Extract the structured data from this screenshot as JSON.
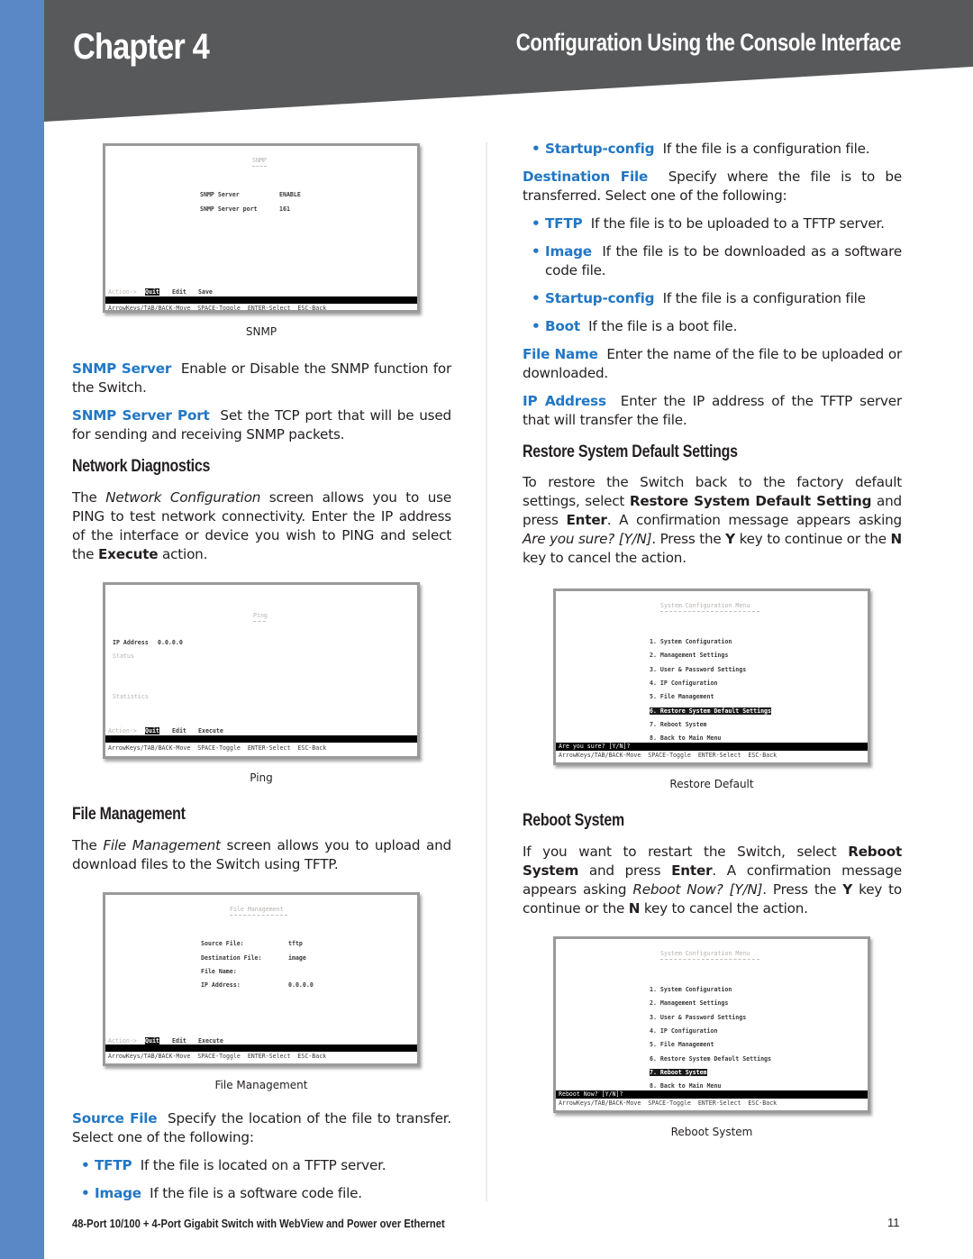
{
  "header": {
    "chapter": "Chapter 4",
    "section_title": "Configuration Using the Console Interface",
    "colors": {
      "band": "#58595b",
      "side_bar": "#5a87c5",
      "term_blue": "#2277c4"
    }
  },
  "left_column": {
    "snmp_figure": {
      "screen_title": "SNMP",
      "fields": [
        {
          "label": "SNMP Server",
          "value": "ENABLE"
        },
        {
          "label": "SNMP Server port",
          "value": "161"
        }
      ],
      "action_prefix": "Action->",
      "actions": [
        "Quit",
        "Edit",
        "Save"
      ],
      "help_line": "ArrowKeys/TAB/BACK-Move  SPACE-Toggle  ENTER-Select  ESC-Back",
      "caption": "SNMP"
    },
    "snmp_server": {
      "term": "SNMP Server",
      "text": "Enable or Disable the SNMP function for the Switch."
    },
    "snmp_server_port": {
      "term": "SNMP Server Port",
      "text": "Set the TCP port that will be used for sending and receiving SNMP packets."
    },
    "network_diagnostics": {
      "heading": "Network Diagnostics",
      "p1": "The ",
      "p_italic": "Network Configuration",
      "p2": " screen allows you to use PING to test network connectivity. Enter the IP address of the interface or device you wish to PING and select the ",
      "p_bold": "Execute",
      "p3": " action."
    },
    "ping_figure": {
      "screen_title": "Ping",
      "ip_label": "IP Address",
      "ip_value": "0.0.0.0",
      "status_label": "Status",
      "statistics_label": "Statistics",
      "action_prefix": "Action->",
      "actions": [
        "Quit",
        "Edit",
        "Execute"
      ],
      "help_line": "ArrowKeys/TAB/BACK-Move  SPACE-Toggle  ENTER-Select  ESC-Back",
      "caption": "Ping"
    },
    "file_management": {
      "heading": "File Management",
      "p1": "The ",
      "p_italic": "File Management",
      "p2": " screen allows you to upload and download files to the Switch using TFTP."
    },
    "file_figure": {
      "screen_title": "File Management",
      "fields": [
        {
          "label": "Source File:",
          "value": "tftp"
        },
        {
          "label": "Destination File:",
          "value": "image"
        },
        {
          "label": "File Name:",
          "value": ""
        },
        {
          "label": "IP Address:",
          "value": "0.0.0.0"
        }
      ],
      "action_prefix": "Action->",
      "actions": [
        "Quit",
        "Edit",
        "Execute"
      ],
      "help_line": "ArrowKeys/TAB/BACK-Move  SPACE-Toggle  ENTER-Select  ESC-Back",
      "caption": "File Management"
    },
    "source_file": {
      "term": "Source File",
      "text": "Specify the location of the file to transfer. Select one of the following:",
      "options": [
        {
          "term": "TFTP",
          "text": "If the file is located on a TFTP server."
        },
        {
          "term": "Image",
          "text": "If the file is a software code file."
        }
      ]
    }
  },
  "right_column": {
    "source_file_continued": {
      "term": "Startup-config",
      "text": "If the file is a configuration file."
    },
    "destination_file": {
      "term": "Destination File",
      "text": "Specify where the file is to be transferred. Select one of the following:",
      "options": [
        {
          "term": "TFTP",
          "text": "If the file is to be uploaded to a TFTP server."
        },
        {
          "term": "Image",
          "text": "If the file is to be downloaded as a software code file."
        },
        {
          "term": "Startup-config",
          "text": "If the file is a configuration file"
        },
        {
          "term": "Boot",
          "text": "If the file is a boot file."
        }
      ]
    },
    "file_name": {
      "term": "File Name",
      "text": "Enter the name of the file to be uploaded or downloaded."
    },
    "ip_address": {
      "term": "IP Address",
      "text": "Enter the IP address of the TFTP server that will transfer the file."
    },
    "restore": {
      "heading": "Restore System Default Settings",
      "p1": "To restore the Switch back to the factory default settings, select ",
      "b1": "Restore System Default Setting",
      "p2": " and press ",
      "b2": "Enter",
      "p3": ". A confirmation message appears asking ",
      "i1": "Are you sure? [Y/N]",
      "p4": ". Press the ",
      "b3": "Y",
      "p5": " key to continue or the ",
      "b4": "N",
      "p6": " key to cancel the action."
    },
    "restore_figure": {
      "screen_title": "System Configuration Menu",
      "menu": [
        "1. System Configuration",
        "2. Management Settings",
        "3. User & Password Settings",
        "4. IP Configuration",
        "5. File Management",
        "6. Restore System Default Settings",
        "7. Reboot System",
        "8. Back to Main Menu"
      ],
      "selected_index": 5,
      "prompt": "Are you sure? [Y/N]?",
      "help_line": "ArrowKeys/TAB/BACK-Move  SPACE-Toggle  ENTER-Select  ESC-Back",
      "caption": "Restore Default"
    },
    "reboot": {
      "heading": "Reboot System",
      "p1": "If you want to restart the Switch, select ",
      "b1": "Reboot System",
      "p2": " and press ",
      "b2": "Enter",
      "p3": ". A confirmation message appears asking ",
      "i1": "Reboot Now? [Y/N]",
      "p4": ". Press the ",
      "b3": "Y",
      "p5": " key to continue or the ",
      "b4": "N",
      "p6": " key to cancel the action."
    },
    "reboot_figure": {
      "screen_title": "System Configuration Menu",
      "menu": [
        "1. System Configuration",
        "2. Management Settings",
        "3. User & Password Settings",
        "4. IP Configuration",
        "5. File Management",
        "6. Restore System Default Settings",
        "7. Reboot System",
        "8. Back to Main Menu"
      ],
      "selected_index": 6,
      "prompt": "Reboot Now? [Y/N]?",
      "help_line": "ArrowKeys/TAB/BACK-Move  SPACE-Toggle  ENTER-Select  ESC-Back",
      "caption": "Reboot System"
    }
  },
  "footer": {
    "product": "48-Port 10/100 + 4-Port Gigabit Switch with WebView and Power over Ethernet",
    "page_number": "11"
  }
}
